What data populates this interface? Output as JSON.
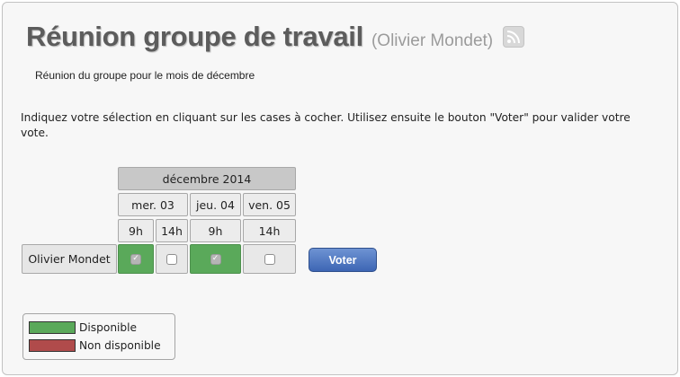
{
  "poll": {
    "title": "Réunion groupe de travail",
    "author": "(Olivier Mondet)",
    "rss_icon": "rss-icon",
    "description": "Réunion du groupe pour le mois de décembre",
    "instructions": "Indiquez votre sélection en cliquant sur les cases à cocher. Utilisez ensuite le bouton \"Voter\" pour valider votre vote."
  },
  "grid": {
    "month": "décembre 2014",
    "days": [
      "mer. 03",
      "jeu. 04",
      "ven. 05"
    ],
    "times": [
      "9h",
      "14h",
      "9h",
      "14h"
    ],
    "participant": "Olivier Mondet",
    "votes": [
      true,
      false,
      true,
      false
    ]
  },
  "vote_button": "Voter",
  "legend": {
    "available": {
      "label": "Disponible",
      "color": "#5aa95a"
    },
    "unavailable": {
      "label": "Non disponible",
      "color": "#b04b4b"
    }
  }
}
